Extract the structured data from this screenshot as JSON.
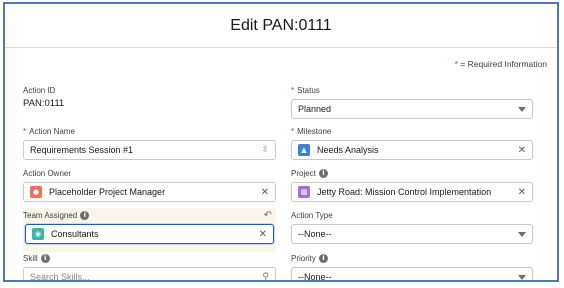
{
  "modal": {
    "title": "Edit PAN:0111"
  },
  "required_note": {
    "star": "*",
    "text": " = Required Information"
  },
  "left": {
    "action_id": {
      "label": "Action ID",
      "value": "PAN:0111"
    },
    "action_name": {
      "star": "*",
      "label": "Action Name",
      "value": "Requirements Session #1",
      "icon": "resize-handle-icon"
    },
    "action_owner": {
      "label": "Action Owner",
      "value": "Placeholder Project Manager",
      "icon": "user-icon",
      "icon_color": "#ef6e5b"
    },
    "team_assigned": {
      "label": "Team Assigned",
      "value": "Consultants",
      "icon": "team-icon",
      "icon_color": "#3bb5a7"
    },
    "skill": {
      "label": "Skill",
      "placeholder": "Search Skills..."
    }
  },
  "right": {
    "status": {
      "star": "*",
      "label": "Status",
      "value": "Planned"
    },
    "milestone": {
      "star": "*",
      "label": "Milestone",
      "value": "Needs Analysis",
      "icon": "milestone-icon",
      "icon_color": "#3e7fd6"
    },
    "project": {
      "label": "Project",
      "value": "Jetty Road: Mission Control Implementation",
      "icon": "project-icon",
      "icon_color": "#a56de3"
    },
    "action_type": {
      "label": "Action Type",
      "value": "--None--"
    },
    "priority": {
      "label": "Priority",
      "value": "--None--"
    }
  },
  "glyphs": {
    "clear": "✕",
    "info": "i",
    "undo": "↶",
    "search": "⚲",
    "resize": "⇳"
  }
}
